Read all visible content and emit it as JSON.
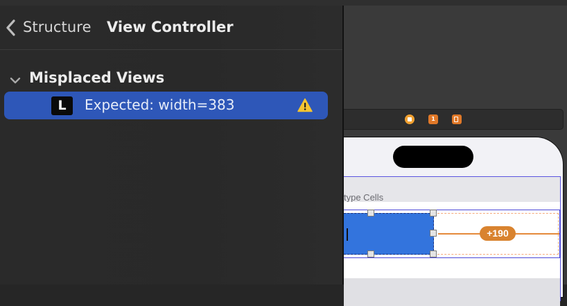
{
  "navigator": {
    "breadcrumb": {
      "parent": "Structure",
      "current": "View Controller"
    },
    "group": {
      "label": "Misplaced Views",
      "expanded": true
    },
    "issue": {
      "badge": "L",
      "text": "Expected: width=383",
      "severity_icon": "warning-icon"
    }
  },
  "canvas": {
    "scene_dock_icons": [
      "view-controller-icon",
      "first-responder-icon",
      "exit-icon"
    ],
    "first_responder_badge": "1",
    "section_header": "type Cells",
    "frame_delta": "+190"
  },
  "colors": {
    "selection": "#2e57b8",
    "cell_view": "#3374dd",
    "misplaced_orange": "#d9832f",
    "constraint_purple": "#5a55e0"
  }
}
